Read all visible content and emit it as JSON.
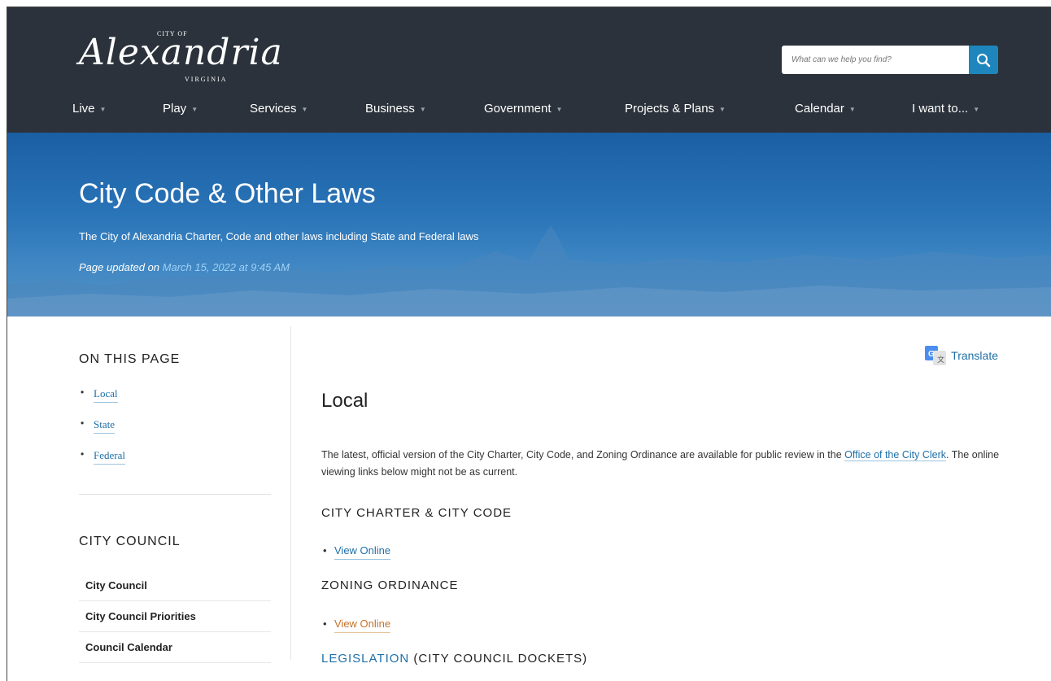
{
  "header": {
    "logo": {
      "city_of": "CITY OF",
      "name": "Alexandria",
      "state": "VIRGINIA"
    },
    "search": {
      "placeholder": "What can we help you find?",
      "icon": "search-icon",
      "button_color": "#1e86bd"
    },
    "nav": [
      {
        "label": "Live"
      },
      {
        "label": "Play"
      },
      {
        "label": "Services"
      },
      {
        "label": "Business"
      },
      {
        "label": "Government"
      },
      {
        "label": "Projects & Plans"
      },
      {
        "label": "Calendar"
      },
      {
        "label": "I want to..."
      }
    ],
    "background": "#2b323b"
  },
  "banner": {
    "title": "City Code & Other Laws",
    "subtitle": "The City of Alexandria Charter, Code and other laws including State and Federal laws",
    "updated_prefix": "Page updated on",
    "updated_date": "March 15, 2022 at 9:45 AM"
  },
  "sidebar": {
    "on_this_page": {
      "heading": "ON THIS PAGE",
      "items": [
        {
          "label": "Local"
        },
        {
          "label": "State"
        },
        {
          "label": "Federal"
        }
      ]
    },
    "city_council": {
      "heading": "CITY COUNCIL",
      "items": [
        {
          "label": "City Council"
        },
        {
          "label": "City Council Priorities"
        },
        {
          "label": "Council Calendar"
        }
      ]
    }
  },
  "main": {
    "translate_label": "Translate",
    "section_title": "Local",
    "intro_text": "The latest, official version of the City Charter, City Code, and Zoning Ordinance are available for public review in the",
    "intro_link": "Office of the City Clerk",
    "intro_tail": ". The online viewing links below might not be as current.",
    "charter_heading": "CITY CHARTER & CITY CODE",
    "charter_link": "View Online",
    "zoning_heading": "ZONING ORDINANCE",
    "zoning_link": "View Online",
    "legislation_link": "LEGISLATION",
    "legislation_tail": " (CITY COUNCIL DOCKETS)"
  }
}
